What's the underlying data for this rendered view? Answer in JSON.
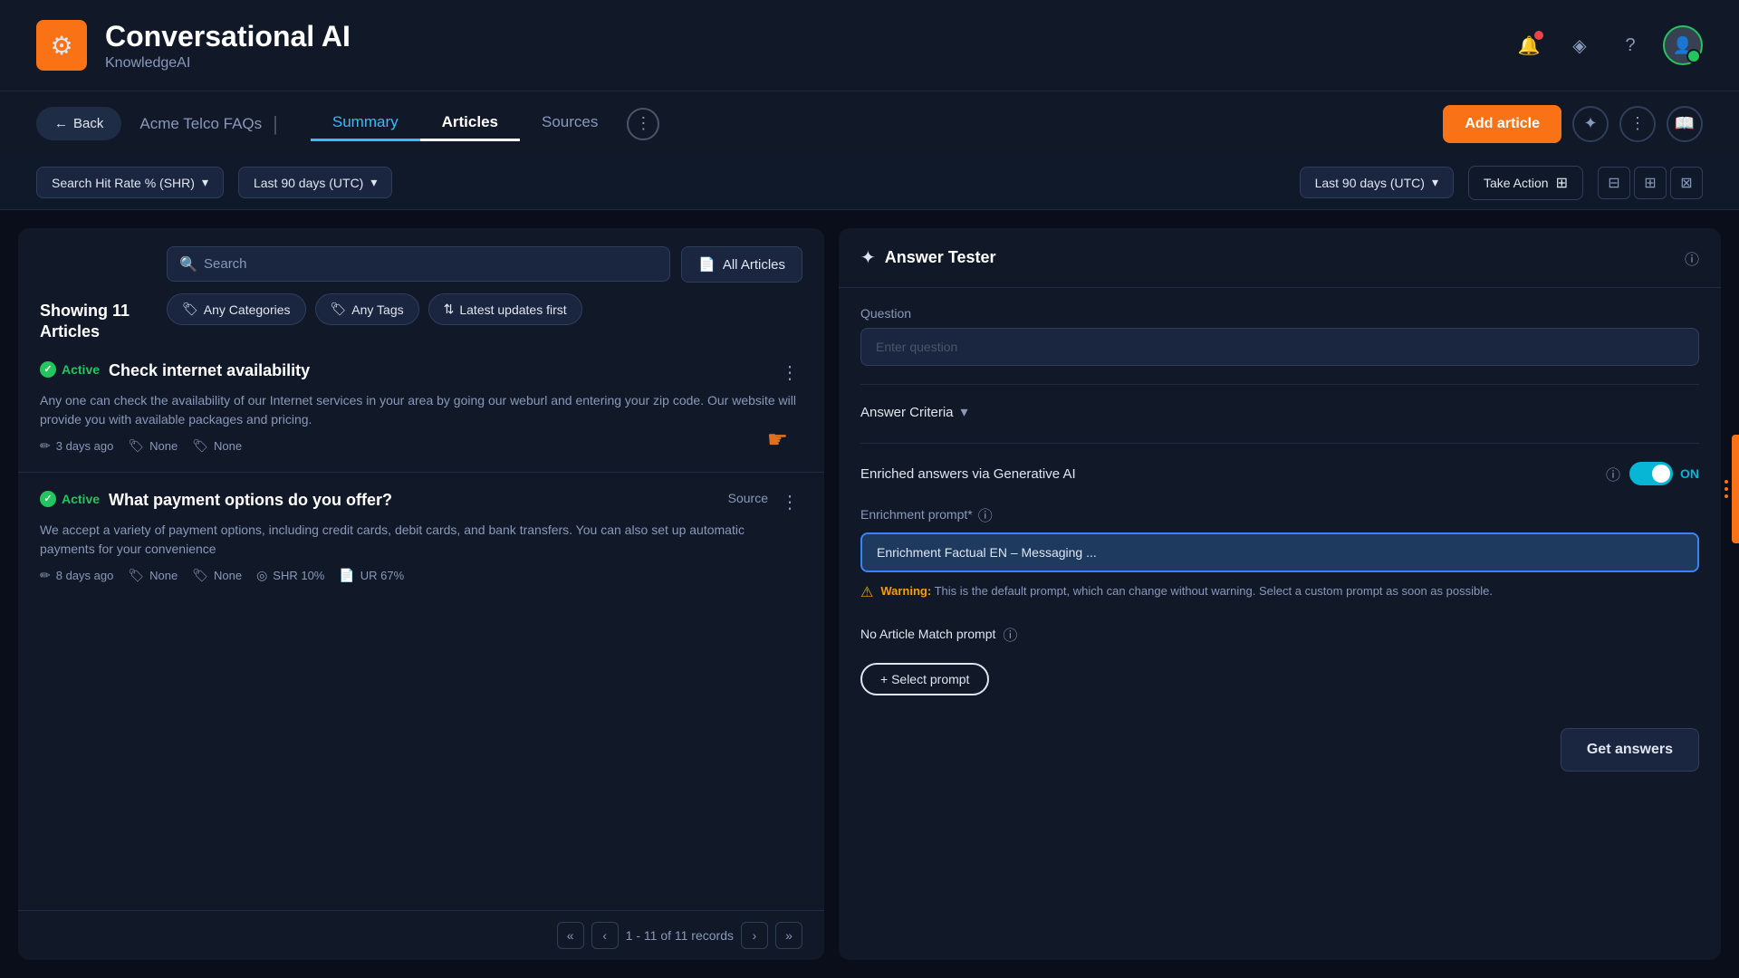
{
  "app": {
    "title": "Conversational AI",
    "subtitle": "KnowledgeAI",
    "logo": "⚙"
  },
  "topnav": {
    "notif_icon": "🔔",
    "layers_icon": "◈",
    "help_icon": "?",
    "avatar_initial": "👤"
  },
  "secondarynav": {
    "back_label": "Back",
    "breadcrumb": "Acme Telco FAQs",
    "tab_summary": "Summary",
    "tab_articles": "Articles",
    "tab_sources": "Sources",
    "add_article": "Add article"
  },
  "filterbar": {
    "left_filter1": "Search Hit Rate % (SHR)",
    "left_filter2": "Last 90 days  (UTC)",
    "right_filter": "Last 90 days  (UTC)",
    "take_action": "Take Action"
  },
  "articles": {
    "showing_count": "Showing 11",
    "showing_unit": "Articles",
    "search_placeholder": "Search",
    "all_articles_label": "All Articles",
    "filter_categories": "Any Categories",
    "filter_tags": "Any Tags",
    "filter_sort": "Latest updates first",
    "list": [
      {
        "id": 1,
        "status": "Active",
        "title": "Check internet availability",
        "description": "Any one can check the availability of our Internet services in your area by going our weburl and entering your zip code. Our website will provide you with available packages and pricing.",
        "date": "3 days ago",
        "tag1": "None",
        "tag2": "None",
        "shr": null,
        "ur": null,
        "has_source": false
      },
      {
        "id": 2,
        "status": "Active",
        "title": "What payment options do you offer?",
        "description": "We accept a variety of payment options, including credit cards, debit cards, and bank transfers. You can also set up automatic payments for your convenience",
        "date": "8 days ago",
        "tag1": "None",
        "tag2": "None",
        "shr": "SHR 10%",
        "ur": "UR 67%",
        "has_source": true
      }
    ]
  },
  "pagination": {
    "range": "1 - 11 of 11 records"
  },
  "answer_tester": {
    "title": "Answer Tester",
    "question_label": "Question",
    "question_placeholder": "Enter question",
    "answer_criteria_label": "Answer Criteria",
    "enriched_label": "Enriched answers via Generative AI",
    "toggle_state": "ON",
    "enrichment_prompt_label": "Enrichment prompt*",
    "enrichment_prompt_value": "Enrichment Factual EN – Messaging ...",
    "warning_label": "Warning:",
    "warning_text": "This is the default prompt, which can change without warning. Select a custom prompt as soon as possible.",
    "no_match_label": "No Article Match prompt",
    "select_prompt_label": "+ Select prompt",
    "get_answers_label": "Get answers"
  }
}
